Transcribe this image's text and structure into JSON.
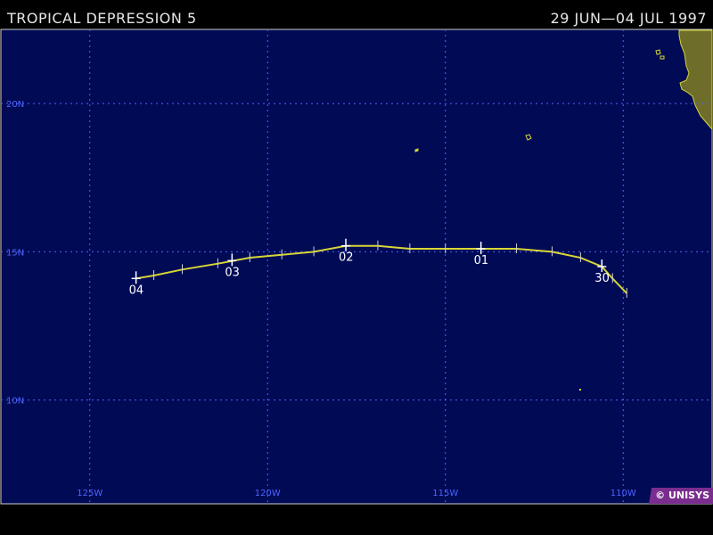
{
  "header": {
    "title": "TROPICAL DEPRESSION 5",
    "date_range": "29 JUN—04 JUL 1997"
  },
  "map": {
    "lon_range": [
      -127.5,
      -107.5
    ],
    "lat_range": [
      6.5,
      22.5
    ],
    "lat_ticks": [
      {
        "value": 20,
        "label": "20N"
      },
      {
        "value": 15,
        "label": "15N"
      },
      {
        "value": 10,
        "label": "10N"
      }
    ],
    "lon_ticks": [
      {
        "value": -125,
        "label": "125W"
      },
      {
        "value": -120,
        "label": "120W"
      },
      {
        "value": -115,
        "label": "115W"
      },
      {
        "value": -110,
        "label": "110W"
      }
    ],
    "colors": {
      "ocean": "#000a55",
      "grid": "#4f64ff",
      "track": "#d6d636",
      "land": "#6e6e2a",
      "coast": "#d6d636",
      "labels": "#ffffff",
      "frame": "#cfcfcf"
    },
    "track": [
      {
        "lon": -109.9,
        "lat": 13.6
      },
      {
        "lon": -110.3,
        "lat": 14.1
      },
      {
        "lon": -110.6,
        "lat": 14.5
      },
      {
        "lon": -111.2,
        "lat": 14.8
      },
      {
        "lon": -112.0,
        "lat": 15.0
      },
      {
        "lon": -113.0,
        "lat": 15.1
      },
      {
        "lon": -114.0,
        "lat": 15.1
      },
      {
        "lon": -115.0,
        "lat": 15.1
      },
      {
        "lon": -116.0,
        "lat": 15.1
      },
      {
        "lon": -116.9,
        "lat": 15.2
      },
      {
        "lon": -117.8,
        "lat": 15.2
      },
      {
        "lon": -118.7,
        "lat": 15.0
      },
      {
        "lon": -119.6,
        "lat": 14.9
      },
      {
        "lon": -120.5,
        "lat": 14.8
      },
      {
        "lon": -121.4,
        "lat": 14.6
      },
      {
        "lon": -122.4,
        "lat": 14.4
      },
      {
        "lon": -123.2,
        "lat": 14.2
      },
      {
        "lon": -123.7,
        "lat": 14.1
      }
    ],
    "day_labels": [
      {
        "label": "30",
        "lon": -110.6,
        "lat": 14.5
      },
      {
        "label": "01",
        "lon": -114.0,
        "lat": 15.1
      },
      {
        "label": "02",
        "lon": -117.8,
        "lat": 15.2
      },
      {
        "label": "03",
        "lon": -121.0,
        "lat": 14.7
      },
      {
        "label": "04",
        "lon": -123.7,
        "lat": 14.1
      }
    ]
  },
  "copyright": "© UNISYS"
}
